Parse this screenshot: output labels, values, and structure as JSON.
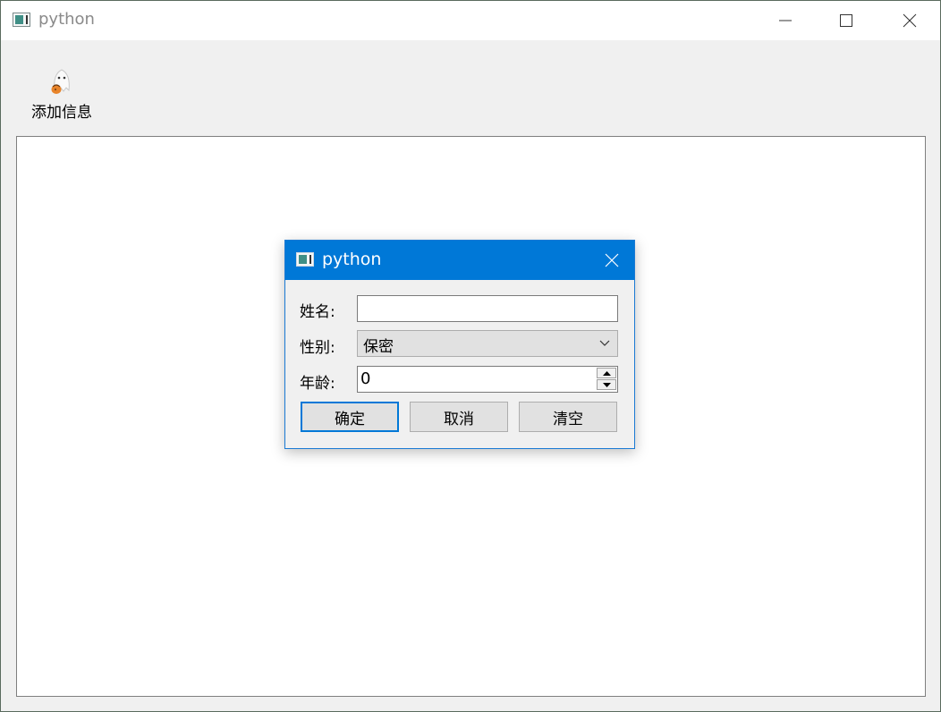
{
  "window": {
    "title": "python",
    "controls": [
      "minimize-icon",
      "maximize-icon",
      "close-icon"
    ]
  },
  "toolbar": {
    "add_info_label": "添加信息",
    "add_info_icon": "ghost-icon"
  },
  "dialog": {
    "title": "python",
    "name_label": "姓名:",
    "name_value": "",
    "gender_label": "性别:",
    "gender_value": "保密",
    "age_label": "年龄:",
    "age_value": "0",
    "ok_label": "确定",
    "cancel_label": "取消",
    "clear_label": "清空"
  },
  "colors": {
    "accent": "#0078d7",
    "window_bg": "#f0f0f0"
  }
}
